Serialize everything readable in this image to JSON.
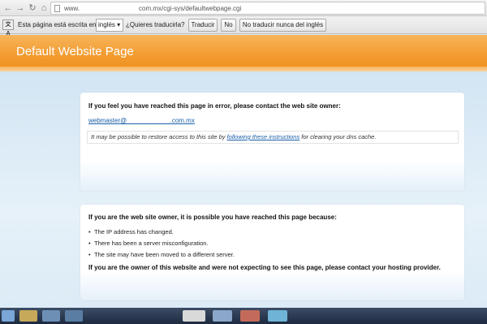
{
  "browser": {
    "url_prefix": "www.",
    "url_rest": "com.mx/cgi-sys/defaultwebpage.cgi"
  },
  "translate_bar": {
    "text_before": "Esta página está escrita en",
    "language": "inglés",
    "question": "¿Quieres traducirla?",
    "translate_button": "Traducir",
    "no_button": "No",
    "never_button": "No traducir nunca del inglés"
  },
  "page": {
    "title": "Default Website Page"
  },
  "error_box": {
    "heading": "If you feel you have reached this page in error, please contact the web site owner:",
    "email": "webmaster@                _      .com.mx",
    "note_before": "It may be possible to restore access to this site by ",
    "note_link": "following these instructions",
    "note_after": " for clearing your dns cache."
  },
  "owner_box": {
    "heading": "If you are the web site owner, it is possible you have reached this page because:",
    "reasons": [
      "The IP address has changed.",
      "There has been a server misconfiguration.",
      "The site may have been moved to a different server."
    ],
    "footer": "If you are the owner of this website and were not expecting to see this page, please contact your hosting provider."
  }
}
